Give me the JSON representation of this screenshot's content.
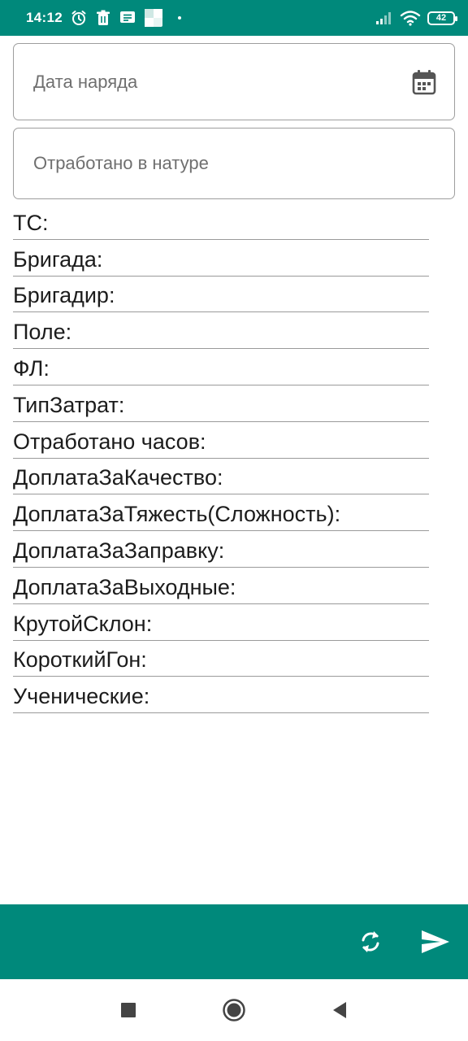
{
  "status_bar": {
    "time": "14:12",
    "battery": "42",
    "icons": [
      "alarm-icon",
      "trash-icon",
      "message-icon",
      "app-icon",
      "signal-icon",
      "wifi-icon",
      "battery-icon"
    ]
  },
  "form": {
    "date_placeholder": "Дата наряда",
    "amount_placeholder": "Отработано в натуре"
  },
  "info_rows": [
    "ТС:",
    "Бригада:",
    "Бригадир:",
    "Поле:",
    "ФЛ:",
    "ТипЗатрат:",
    "Отработано часов:",
    "ДоплатаЗаКачество:",
    "ДоплатаЗаТяжесть(Сложность):",
    "ДоплатаЗаЗаправку:",
    "ДоплатаЗаВыходные:",
    "КрутойСклон:",
    "КороткийГон:",
    "Ученические:"
  ],
  "toolbar": {
    "icons": [
      "refresh-icon",
      "send-icon"
    ]
  },
  "navigation": {
    "icons": [
      "recent-apps-icon",
      "home-icon",
      "back-icon"
    ]
  },
  "colors": {
    "primary": "#00897b",
    "border": "#9e9e9e",
    "text": "#1c1c1c"
  }
}
